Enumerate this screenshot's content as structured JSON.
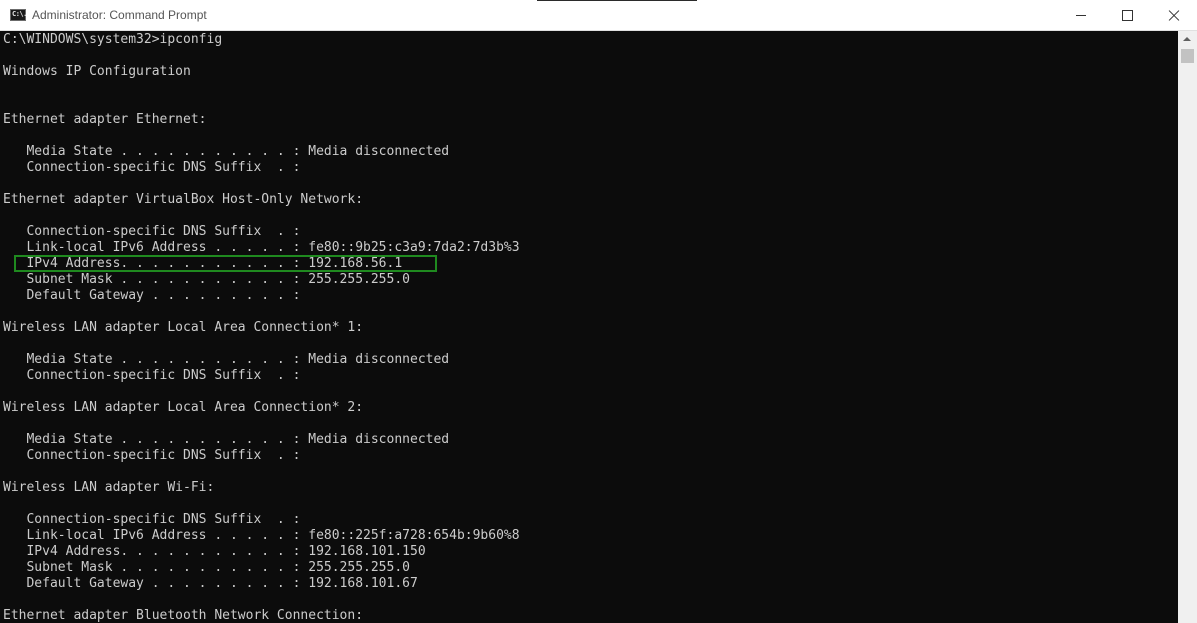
{
  "window": {
    "title": "Administrator: Command Prompt",
    "icon_label": "C:\\."
  },
  "console": {
    "lines": [
      "C:\\WINDOWS\\system32>ipconfig",
      "",
      "Windows IP Configuration",
      "",
      "",
      "Ethernet adapter Ethernet:",
      "",
      "   Media State . . . . . . . . . . . : Media disconnected",
      "   Connection-specific DNS Suffix  . :",
      "",
      "Ethernet adapter VirtualBox Host-Only Network:",
      "",
      "   Connection-specific DNS Suffix  . :",
      "   Link-local IPv6 Address . . . . . : fe80::9b25:c3a9:7da2:7d3b%3",
      "   IPv4 Address. . . . . . . . . . . : 192.168.56.1",
      "   Subnet Mask . . . . . . . . . . . : 255.255.255.0",
      "   Default Gateway . . . . . . . . . :",
      "",
      "Wireless LAN adapter Local Area Connection* 1:",
      "",
      "   Media State . . . . . . . . . . . : Media disconnected",
      "   Connection-specific DNS Suffix  . :",
      "",
      "Wireless LAN adapter Local Area Connection* 2:",
      "",
      "   Media State . . . . . . . . . . . : Media disconnected",
      "   Connection-specific DNS Suffix  . :",
      "",
      "Wireless LAN adapter Wi-Fi:",
      "",
      "   Connection-specific DNS Suffix  . :",
      "   Link-local IPv6 Address . . . . . : fe80::225f:a728:654b:9b60%8",
      "   IPv4 Address. . . . . . . . . . . : 192.168.101.150",
      "   Subnet Mask . . . . . . . . . . . : 255.255.255.0",
      "   Default Gateway . . . . . . . . . : 192.168.101.67",
      "",
      "Ethernet adapter Bluetooth Network Connection:"
    ],
    "highlighted_line": 14
  },
  "colors": {
    "console_background": "#0c0c0c",
    "console_text": "#cccccc",
    "highlight_border": "#1f8a1f",
    "titlebar_background": "#ffffff"
  },
  "icons": {
    "app": "command-prompt-icon",
    "minimize": "minimize-icon",
    "maximize": "maximize-icon",
    "close": "close-icon",
    "scroll_up": "scroll-up-arrow-icon"
  }
}
